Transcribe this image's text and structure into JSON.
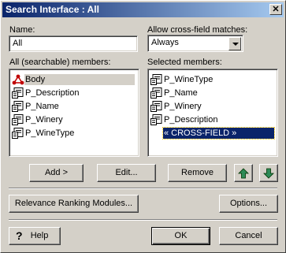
{
  "window": {
    "title": "Search Interface : All"
  },
  "name_field": {
    "label": "Name:",
    "value": "All"
  },
  "cross_field": {
    "label": "Allow cross-field matches:",
    "value": "Always"
  },
  "all_members": {
    "label": "All (searchable) members:",
    "items": [
      "Body",
      "P_Description",
      "P_Name",
      "P_Winery",
      "P_WineType"
    ]
  },
  "selected_members": {
    "label": "Selected members:",
    "items": [
      "P_WineType",
      "P_Name",
      "P_Winery",
      "P_Description"
    ],
    "cross_field_item": "« CROSS-FIELD »"
  },
  "buttons": {
    "add": "Add >",
    "edit": "Edit...",
    "remove": "Remove",
    "relevance": "Relevance Ranking Modules...",
    "options": "Options...",
    "help": "Help",
    "ok": "OK",
    "cancel": "Cancel"
  },
  "colors": {
    "title_start": "#0a246a",
    "title_end": "#a6caf0",
    "selection": "#0a246a",
    "arrow_green": "#2e8b57"
  }
}
